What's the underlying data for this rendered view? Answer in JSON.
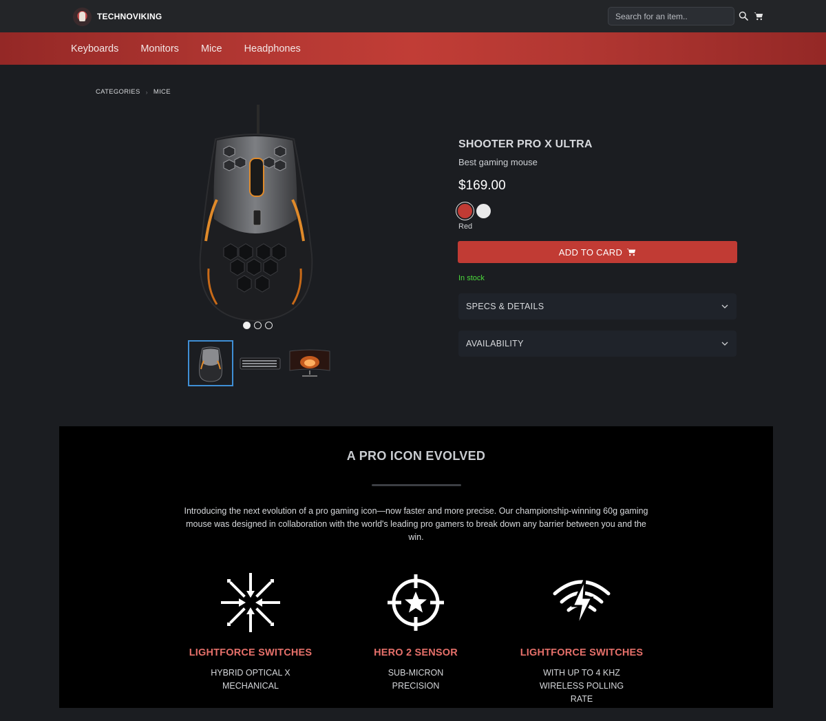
{
  "header": {
    "brand": "TECHNOVIKING",
    "search_placeholder": "Search for an item.."
  },
  "nav": {
    "items": [
      "Keyboards",
      "Monitors",
      "Mice",
      "Headphones"
    ]
  },
  "breadcrumb": [
    "CATEGORIES",
    "MICE"
  ],
  "product": {
    "title": "SHOOTER PRO X ULTRA",
    "subtitle": "Best gaming mouse",
    "price": "$169.00",
    "colors": [
      {
        "name": "Red",
        "hex": "#c13b34",
        "selected": true
      },
      {
        "name": "White",
        "hex": "#e9e9ea",
        "selected": false
      }
    ],
    "selected_color_label": "Red",
    "add_button": "ADD TO CARD",
    "stock": "In stock",
    "stock_color": "#4cdb3c",
    "accordions": [
      "SPECS & DETAILS",
      "AVAILABILITY"
    ],
    "carousel_count": 3,
    "carousel_active": 0,
    "thumbnails": [
      "mouse",
      "keyboard",
      "monitor"
    ]
  },
  "feature": {
    "title": "A PRO ICON EVOLVED",
    "description": "Introducing the next evolution of a pro gaming icon—now faster and more precise. Our championship-winning 60g gaming mouse was designed in collaboration with the world's leading pro gamers to break down any barrier between you and the win.",
    "columns": [
      {
        "icon": "burst-arrows-icon",
        "title": "LIGHTFORCE SWITCHES",
        "text": "HYBRID OPTICAL X MECHANICAL"
      },
      {
        "icon": "crosshair-star-icon",
        "title": "HERO 2 SENSOR",
        "text": "SUB-MICRON PRECISION"
      },
      {
        "icon": "wireless-bolt-icon",
        "title": "LIGHTFORCE SWITCHES",
        "text": "WITH UP TO 4 KHZ WIRELESS POLLING RATE"
      }
    ]
  },
  "colors": {
    "accent": "#c13b34",
    "feature_title": "#e6706a",
    "background": "#1b1d21"
  }
}
